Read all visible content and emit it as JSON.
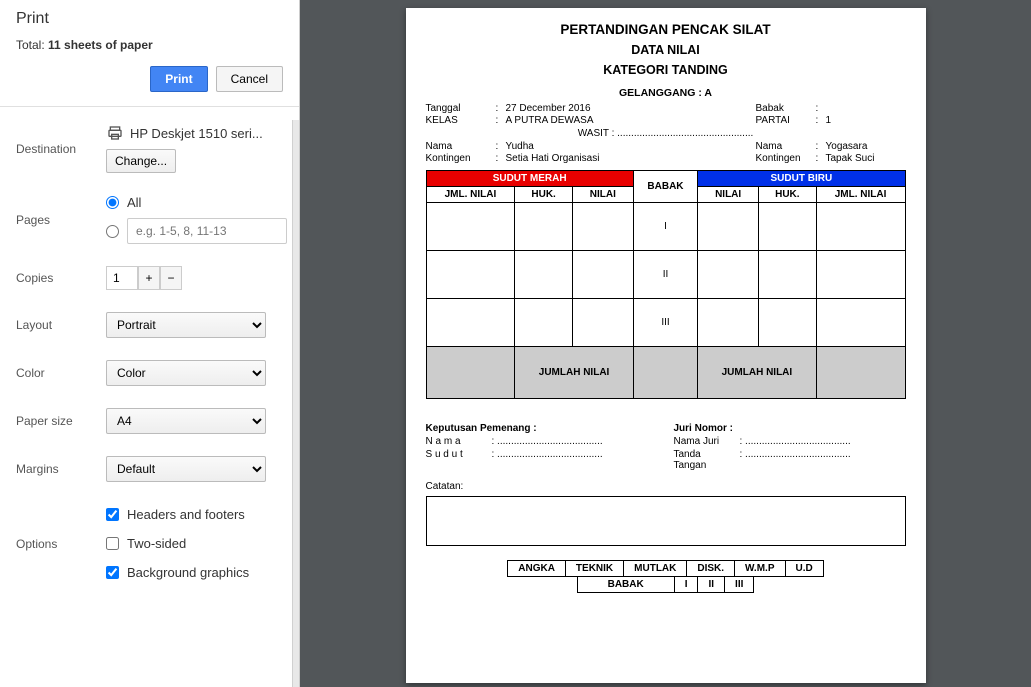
{
  "dialog": {
    "title": "Print",
    "total_label": "Total: ",
    "total_count": "11 sheets of paper",
    "print_btn": "Print",
    "cancel_btn": "Cancel"
  },
  "settings": {
    "destination_label": "Destination",
    "printer_name": "HP Deskjet 1510 seri...",
    "change_btn": "Change...",
    "pages_label": "Pages",
    "pages_all": "All",
    "pages_placeholder": "e.g. 1-5, 8, 11-13",
    "copies_label": "Copies",
    "copies_value": "1",
    "layout_label": "Layout",
    "layout_value": "Portrait",
    "color_label": "Color",
    "color_value": "Color",
    "paper_label": "Paper size",
    "paper_value": "A4",
    "margins_label": "Margins",
    "margins_value": "Default",
    "options_label": "Options",
    "opt_hf": "Headers and footers",
    "opt_ts": "Two-sided",
    "opt_bg": "Background graphics"
  },
  "doc": {
    "h1": "PERTANDINGAN PENCAK SILAT",
    "h2": "DATA NILAI",
    "h3": "KATEGORI TANDING",
    "gelanggang": "GELANGGANG : A",
    "tanggal_k": "Tanggal",
    "tanggal_v": "27 December 2016",
    "babak_k": "Babak",
    "babak_v": "",
    "kelas_k": "KELAS",
    "kelas_v": "A PUTRA DEWASA",
    "partai_k": "PARTAI",
    "partai_v": "1",
    "wasit": "WASIT : .................................................",
    "nama1_k": "Nama",
    "nama1_v": "Yudha",
    "nama2_k": "Nama",
    "nama2_v": "Yogasara",
    "kon1_k": "Kontingen",
    "kon1_v": "Setia Hati Organisasi",
    "kon2_k": "Kontingen",
    "kon2_v": "Tapak Suci",
    "tbl": {
      "sudut_merah": "SUDUT MERAH",
      "sudut_biru": "SUDUT BIRU",
      "babak": "BABAK",
      "jml_nilai": "JML. NILAI",
      "huk": "HUK.",
      "nilai": "NILAI",
      "r1": "I",
      "r2": "II",
      "r3": "III",
      "jumlah": "JUMLAH NILAI"
    },
    "kp_title": "Keputusan Pemenang :",
    "kp_nama_k": "N a m a",
    "kp_sudut_k": "S u d u t",
    "jn_title": "Juri Nomor :",
    "jn_nama_k": "Nama Juri",
    "jn_tt_k": "Tanda Tangan",
    "dotted": ": ......................................",
    "catatan": "Catatan:",
    "res1": [
      "ANGKA",
      "TEKNIK",
      "MUTLAK",
      "DISK.",
      "W.M.P",
      "U.D"
    ],
    "res2": [
      "BABAK",
      "I",
      "II",
      "III"
    ]
  }
}
